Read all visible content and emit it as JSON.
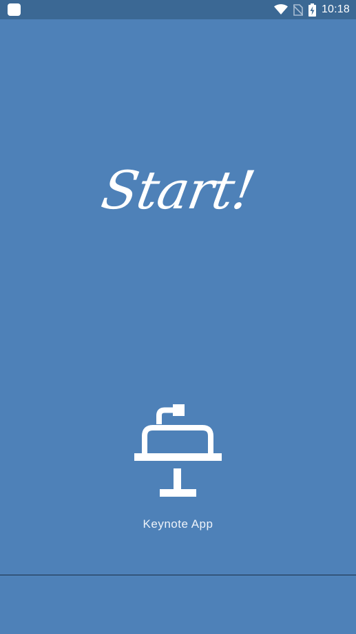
{
  "status_bar": {
    "time": "10:18",
    "icons": [
      "app-notification-icon",
      "wifi-icon",
      "no-sim-icon",
      "battery-charging-icon"
    ]
  },
  "main": {
    "title": "Start!",
    "app_icon": "keynote-icon",
    "app_label": "Keynote App"
  },
  "colors": {
    "background": "#4e81b8",
    "status_bar": "#3b6894",
    "foreground": "#ffffff",
    "divider": "#1b2f45"
  }
}
